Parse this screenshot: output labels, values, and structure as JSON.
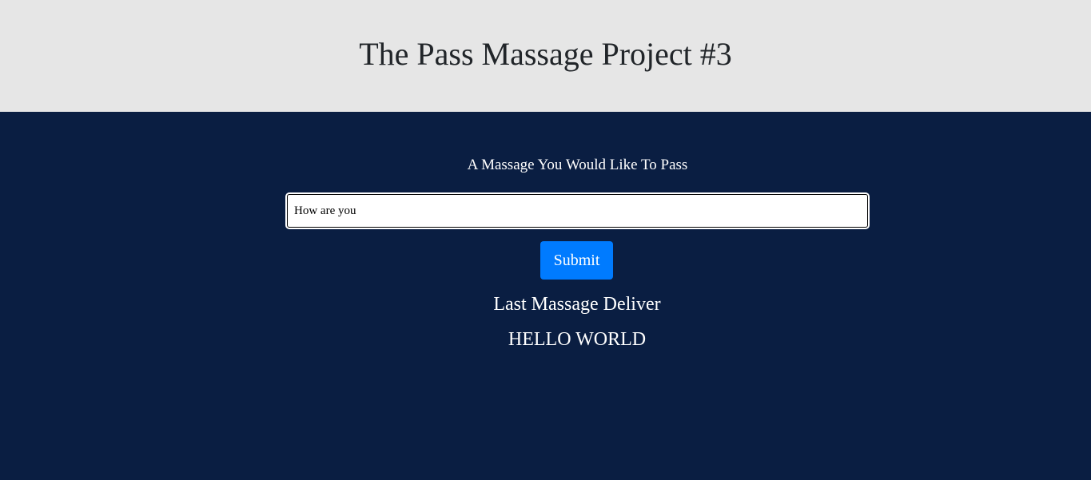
{
  "header": {
    "title": "The Pass Massage Project #3"
  },
  "form": {
    "label": "A Massage You Would Like To Pass",
    "input_value": "How are you",
    "submit_label": "Submit"
  },
  "result": {
    "heading": "Last Massage Deliver",
    "message": "HELLO WORLD"
  },
  "colors": {
    "header_bg": "#e6e6e6",
    "main_bg": "#0a1e42",
    "button_bg": "#007bff"
  }
}
